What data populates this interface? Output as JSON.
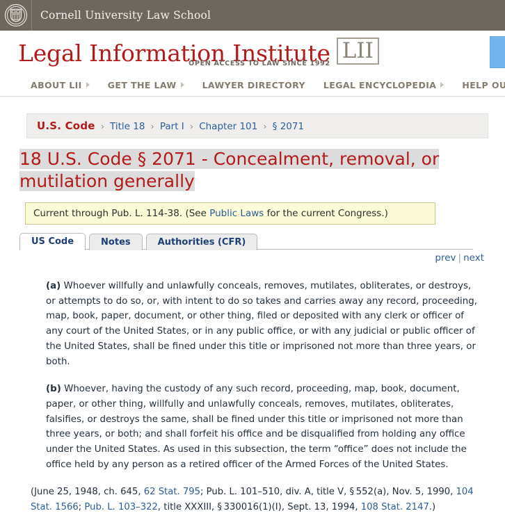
{
  "cornell_bar": {
    "seal_icon": "cornell-seal-icon",
    "title": "Cornell University Law School"
  },
  "masthead": {
    "logo_name": "Legal Information Institute",
    "tagline": "OPEN ACCESS TO LAW SINCE 1992",
    "mark": "LII",
    "search_button_icon": "search-icon",
    "search_button_color": "#74b4ec"
  },
  "mainnav": {
    "items": [
      {
        "label": "ABOUT LII",
        "caret": true
      },
      {
        "label": "GET THE LAW",
        "caret": true
      },
      {
        "label": "LAWYER DIRECTORY",
        "caret": false
      },
      {
        "label": "LEGAL ENCYCLOPEDIA",
        "caret": true
      },
      {
        "label": "HELP OUT",
        "caret": false
      }
    ]
  },
  "breadcrumb": {
    "root": "U.S. Code",
    "separator": "›",
    "items": [
      "Title 18",
      "Part I",
      "Chapter 101",
      "§ 2071"
    ]
  },
  "page_title": "18 U.S. Code § 2071 - Concealment, removal, or mutilation generally",
  "notice": {
    "prefix": "Current through Pub. L. 114-38. (See ",
    "link": "Public Laws",
    "suffix": " for the current Congress.)"
  },
  "tabs": [
    {
      "label": "US Code",
      "active": true
    },
    {
      "label": "Notes",
      "active": false
    },
    {
      "label": "Authorities (CFR)",
      "active": false
    }
  ],
  "pager": {
    "prev": "prev",
    "sep": "|",
    "next": "next"
  },
  "statute": {
    "paragraphs": [
      {
        "label": "(a)",
        "text": " Whoever willfully and unlawfully conceals, removes, mutilates, obliterates, or destroys, or attempts to do so, or, with intent to do so takes and carries away any record, proceeding, map, book, paper, document, or other thing, filed or deposited with any clerk or officer of any court of the United States, or in any public office, or with any judicial or public officer of the United States, shall be fined under this title or imprisoned not more than three years, or both."
      },
      {
        "label": "(b)",
        "text": " Whoever, having the custody of any such record, proceeding, map, book, document, paper, or other thing, willfully and unlawfully conceals, removes, mutilates, obliterates, falsifies, or destroys the same, shall be fined under this title or imprisoned not more than three years, or both; and shall forfeit his office and be disqualified from holding any office under the United States. As used in this subsection, the term “office” does not include the office held by any person as a retired officer of the Armed Forces of the United States."
      }
    ]
  },
  "credits": {
    "part1": "(June 25, 1948, ch. 645, ",
    "link1": "62 Stat. 795",
    "part2": "; Pub. L. 101–510, div. A, title V, § 552(a), Nov. 5, 1990, ",
    "link2": "104 Stat. 1566",
    "part3": "; ",
    "link3": "Pub. L. 103–322",
    "part4": ", title XXXIII, § 330016(1)(I), Sept. 13, 1994, ",
    "link4": "108 Stat. 2147",
    "part5": ".)"
  }
}
